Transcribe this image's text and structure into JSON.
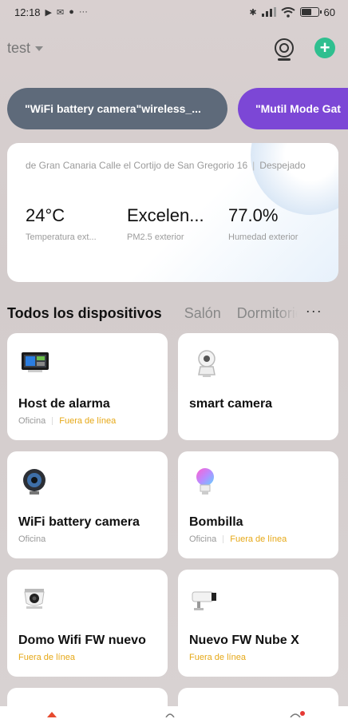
{
  "status": {
    "time": "12:18",
    "battery": "60",
    "battery_level": 0.6,
    "more": "···"
  },
  "header": {
    "home_name": "test"
  },
  "scenes": [
    {
      "label": "\"WiFi battery camera\"wireless_...",
      "color": "#5e6a7a"
    },
    {
      "label": "\"Mutil Mode Gat",
      "color": "#7c47d6"
    }
  ],
  "weather": {
    "location": "de Gran Canaria Calle el Cortijo de San Gregorio 16",
    "separator": "|",
    "condition": "Despejado",
    "metrics": [
      {
        "value": "24°C",
        "label": "Temperatura ext..."
      },
      {
        "value": "Excelen...",
        "label": "PM2.5 exterior"
      },
      {
        "value": "77.0%",
        "label": "Humedad exterior"
      }
    ]
  },
  "tabs": {
    "all": "Todos los dispositivos",
    "room1": "Salón",
    "room2": "Dormitorio",
    "more": "···"
  },
  "devices": [
    {
      "name": "Host de alarma",
      "room": "Oficina",
      "status": "Fuera de línea",
      "icon": "alarm-host-icon"
    },
    {
      "name": "smart camera",
      "room": "",
      "status": "",
      "icon": "smart-camera-icon"
    },
    {
      "name": "WiFi battery camera",
      "room": "Oficina",
      "status": "",
      "icon": "battery-camera-icon"
    },
    {
      "name": "Bombilla",
      "room": "Oficina",
      "status": "Fuera de línea",
      "icon": "bulb-icon"
    },
    {
      "name": "Domo Wifi FW nuevo",
      "room": "",
      "status": "Fuera de línea",
      "icon": "dome-camera-icon"
    },
    {
      "name": "Nuevo FW Nube X",
      "room": "",
      "status": "Fuera de línea",
      "icon": "bullet-camera-icon"
    }
  ],
  "colors": {
    "accent": "#2fbf8f",
    "offline": "#e6a817",
    "notification": "#e53935"
  }
}
